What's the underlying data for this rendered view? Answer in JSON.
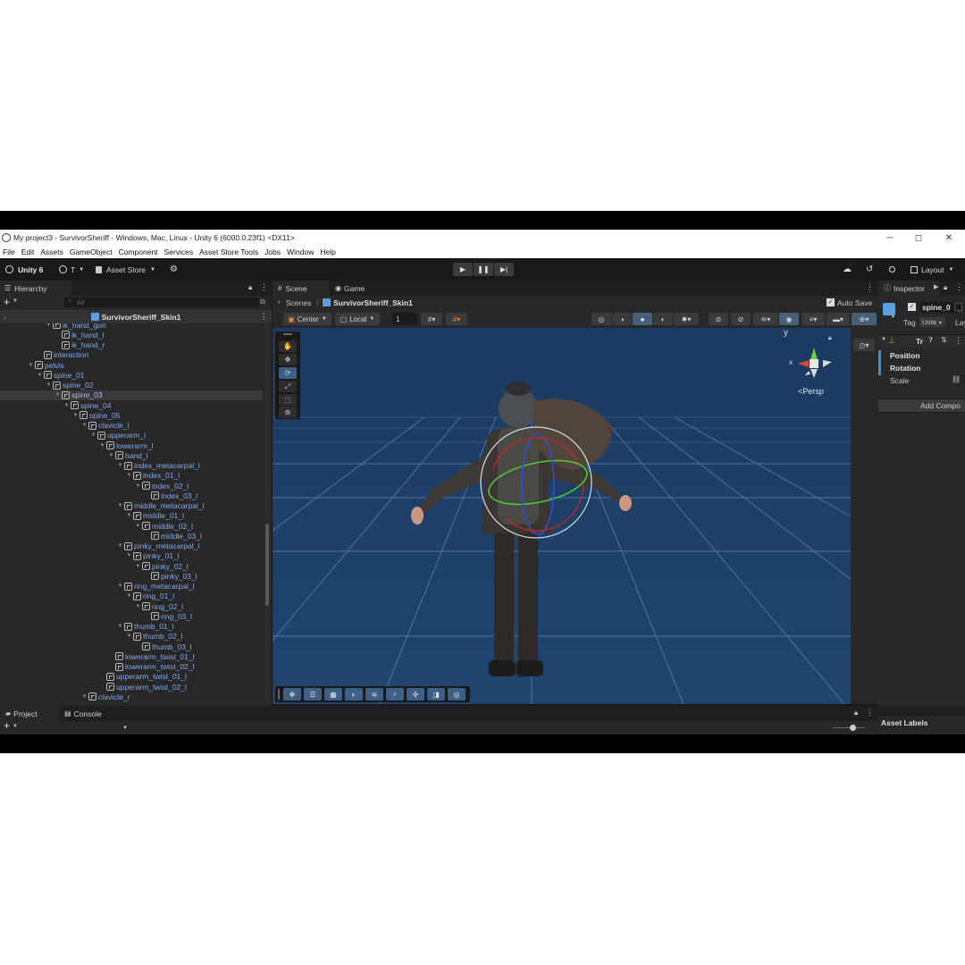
{
  "window": {
    "title": "My project3 - SurvivorSheriff - Windows, Mac, Linux - Unity 6 (6000.0.23f1) <DX11>",
    "minimize": "─",
    "maximize": "◻",
    "close": "✕"
  },
  "menu": [
    "File",
    "Edit",
    "Assets",
    "GameObject",
    "Component",
    "Services",
    "Asset Store Tools",
    "Jobs",
    "Window",
    "Help"
  ],
  "toolbar": {
    "unity_label": "Unity 6",
    "account_label": "T",
    "asset_store_label": "Asset Store",
    "layout_label": "Layout"
  },
  "hierarchy": {
    "tab_label": "Hierarchy",
    "search_placeholder": "All",
    "scene_name": "SurvivorSheriff_Skin1",
    "rows": [
      {
        "label": "ik_hand_gun",
        "indent": 7,
        "arrow": "▼"
      },
      {
        "label": "ik_hand_l",
        "indent": 8,
        "arrow": ""
      },
      {
        "label": "ik_hand_r",
        "indent": 8,
        "arrow": ""
      },
      {
        "label": "interaction",
        "indent": 6,
        "arrow": ""
      },
      {
        "label": "pelvis",
        "indent": 5,
        "arrow": "▼"
      },
      {
        "label": "spine_01",
        "indent": 6,
        "arrow": "▼"
      },
      {
        "label": "spine_02",
        "indent": 7,
        "arrow": "▼"
      },
      {
        "label": "spine_03",
        "indent": 8,
        "arrow": "▼",
        "selected": true
      },
      {
        "label": "spine_04",
        "indent": 9,
        "arrow": "▼"
      },
      {
        "label": "spine_05",
        "indent": 10,
        "arrow": "▼"
      },
      {
        "label": "clavicle_l",
        "indent": 11,
        "arrow": "▼"
      },
      {
        "label": "upperarm_l",
        "indent": 12,
        "arrow": "▼"
      },
      {
        "label": "lowerarm_l",
        "indent": 13,
        "arrow": "▼"
      },
      {
        "label": "hand_l",
        "indent": 14,
        "arrow": "▼"
      },
      {
        "label": "index_metacarpal_l",
        "indent": 15,
        "arrow": "▼"
      },
      {
        "label": "index_01_l",
        "indent": 16,
        "arrow": "▼"
      },
      {
        "label": "index_02_l",
        "indent": 17,
        "arrow": "▼"
      },
      {
        "label": "index_03_l",
        "indent": 18,
        "arrow": ""
      },
      {
        "label": "middle_metacarpal_l",
        "indent": 15,
        "arrow": "▼"
      },
      {
        "label": "middle_01_l",
        "indent": 16,
        "arrow": "▼"
      },
      {
        "label": "middle_02_l",
        "indent": 17,
        "arrow": "▼"
      },
      {
        "label": "middle_03_l",
        "indent": 18,
        "arrow": ""
      },
      {
        "label": "pinky_metacarpal_l",
        "indent": 15,
        "arrow": "▼"
      },
      {
        "label": "pinky_01_l",
        "indent": 16,
        "arrow": "▼"
      },
      {
        "label": "pinky_02_l",
        "indent": 17,
        "arrow": "▼"
      },
      {
        "label": "pinky_03_l",
        "indent": 18,
        "arrow": ""
      },
      {
        "label": "ring_metacarpal_l",
        "indent": 15,
        "arrow": "▼"
      },
      {
        "label": "ring_01_l",
        "indent": 16,
        "arrow": "▼"
      },
      {
        "label": "ring_02_l",
        "indent": 17,
        "arrow": "▼"
      },
      {
        "label": "ring_03_l",
        "indent": 18,
        "arrow": ""
      },
      {
        "label": "thumb_01_l",
        "indent": 15,
        "arrow": "▼"
      },
      {
        "label": "thumb_02_l",
        "indent": 16,
        "arrow": "▼"
      },
      {
        "label": "thumb_03_l",
        "indent": 17,
        "arrow": ""
      },
      {
        "label": "lowerarm_twist_01_l",
        "indent": 14,
        "arrow": ""
      },
      {
        "label": "lowerarm_twist_02_l",
        "indent": 14,
        "arrow": ""
      },
      {
        "label": "upperarm_twist_01_l",
        "indent": 13,
        "arrow": ""
      },
      {
        "label": "upperarm_twist_02_l",
        "indent": 13,
        "arrow": ""
      },
      {
        "label": "clavicle_r",
        "indent": 11,
        "arrow": "▼"
      }
    ]
  },
  "scene": {
    "tab_scene": "Scene",
    "tab_game": "Game",
    "breadcrumb_root": "Scenes",
    "breadcrumb_item": "SurvivorSheriff_Skin1",
    "auto_save": "Auto Save",
    "pivot_mode": "Center",
    "pivot_rotation": "Local",
    "grid_snap": "1",
    "persp_label": "<Persp",
    "axis_x": "x",
    "axis_y": "y"
  },
  "inspector": {
    "tab_label": "Inspector",
    "object_name": "spine_0",
    "tag_label": "Tag",
    "tag_value": "Unta",
    "layer_label": "Lay",
    "component_label": "Tr",
    "position_label": "Position",
    "rotation_label": "Rotation",
    "scale_label": "Scale",
    "add_component": "Add Compo",
    "asset_labels": "Asset Labels"
  },
  "bottom": {
    "tab_project": "Project",
    "tab_console": "Console"
  },
  "colors": {
    "editor_bg": "#191919",
    "panel_bg": "#282828",
    "viewport_bg": "#1d3e67",
    "hierarchy_text": "#7eaaf0",
    "accent_blue": "#3e5f86"
  }
}
